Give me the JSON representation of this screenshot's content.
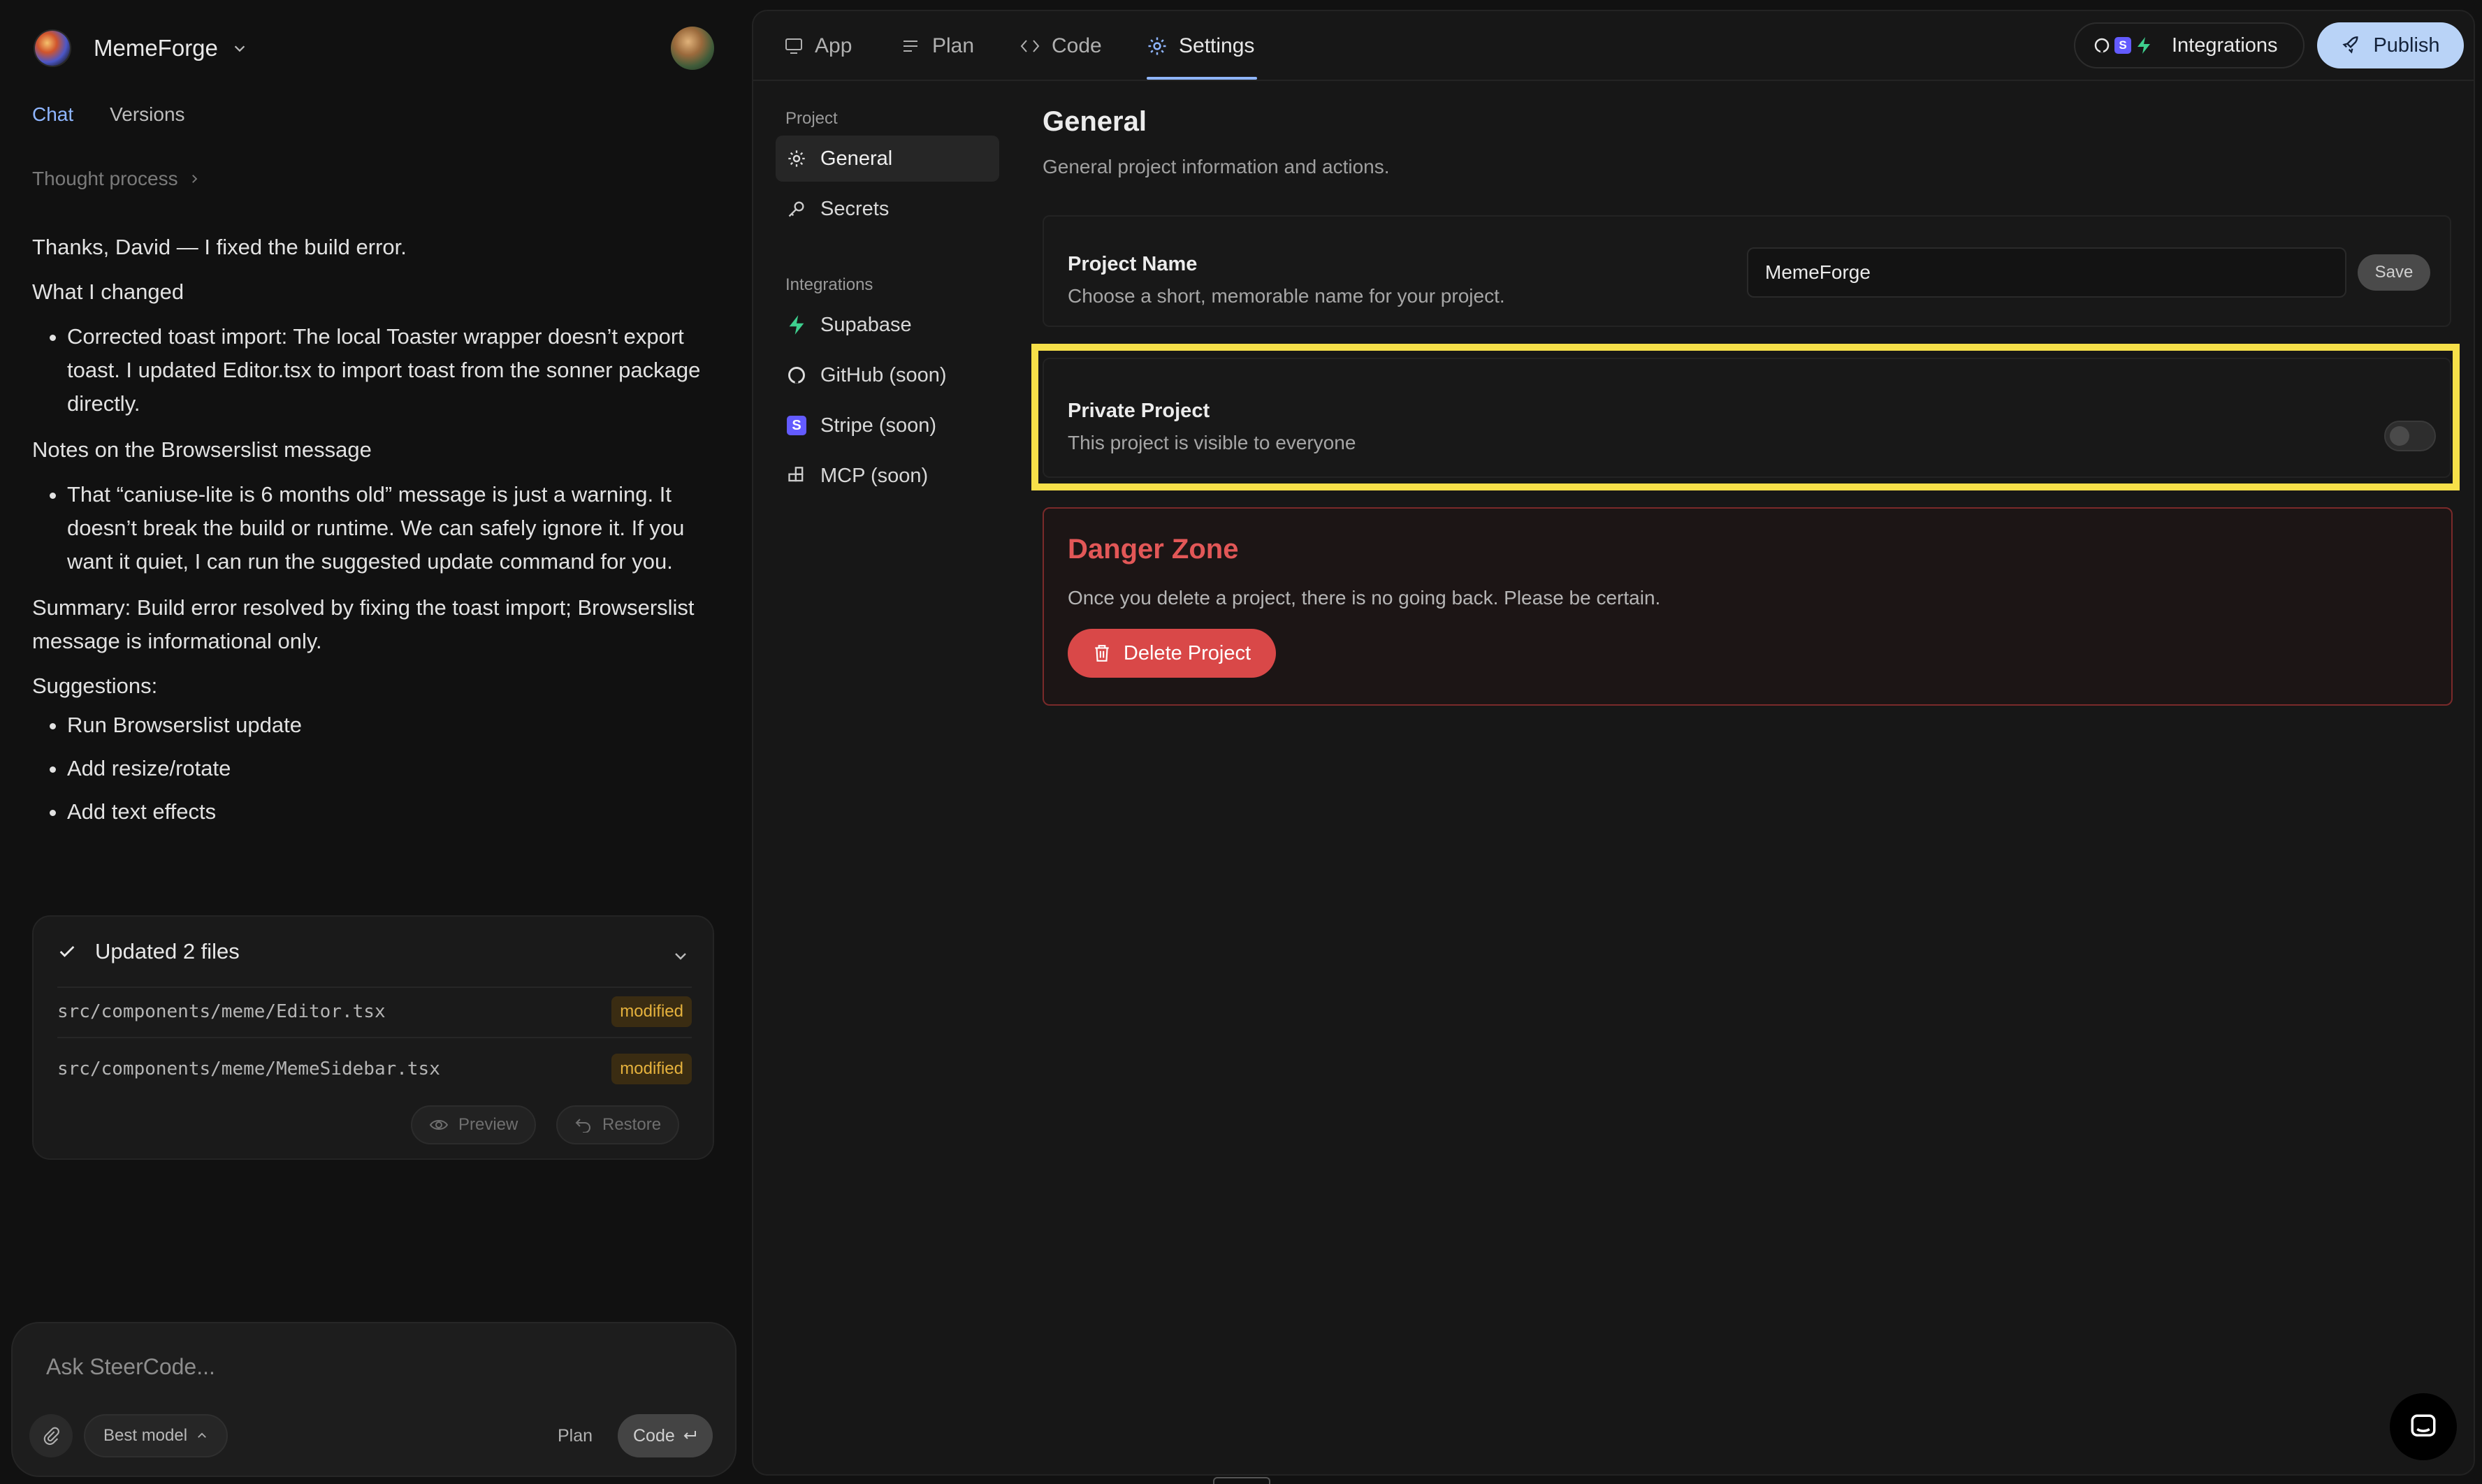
{
  "project": {
    "name": "MemeForge"
  },
  "left_tabs": [
    "Chat",
    "Versions"
  ],
  "thought": "Thought process",
  "message": {
    "greeting": "Thanks, David — I fixed the build error.",
    "changed_heading": "What I changed",
    "changed_items": [
      "Corrected toast import: The local Toaster wrapper doesn’t export toast. I updated Editor.tsx to import toast from the sonner package directly."
    ],
    "notes_heading": "Notes on the Browserslist message",
    "notes_items": [
      "That “caniuse-lite is 6 months old” message is just a warning. It doesn’t break the build or runtime. We can safely ignore it. If you want it quiet, I can run the suggested update command for you."
    ],
    "summary": "Summary: Build error resolved by fixing the toast import; Browserslist message is informational only.",
    "suggestions_heading": "Suggestions:",
    "suggestions": [
      "Run Browserslist update",
      "Add resize/rotate",
      "Add text effects"
    ]
  },
  "files": {
    "title": "Updated 2 files",
    "items": [
      {
        "path": "src/components/meme/Editor.tsx",
        "status": "modified"
      },
      {
        "path": "src/components/meme/MemeSidebar.tsx",
        "status": "modified"
      }
    ],
    "preview_label": "Preview",
    "restore_label": "Restore"
  },
  "composer": {
    "placeholder": "Ask SteerCode...",
    "model_label": "Best model",
    "plan_label": "Plan",
    "code_label": "Code"
  },
  "top_tabs": [
    {
      "label": "App",
      "icon": "monitor-icon"
    },
    {
      "label": "Plan",
      "icon": "list-icon"
    },
    {
      "label": "Code",
      "icon": "code-icon"
    },
    {
      "label": "Settings",
      "icon": "gear-icon"
    }
  ],
  "integrations_label": "Integrations",
  "publish_label": "Publish",
  "sidenav": {
    "project_heading": "Project",
    "project_items": [
      {
        "label": "General",
        "icon": "gear-icon"
      },
      {
        "label": "Secrets",
        "icon": "key-icon"
      }
    ],
    "integrations_heading": "Integrations",
    "integration_items": [
      {
        "label": "Supabase",
        "icon": "supabase-icon"
      },
      {
        "label": "GitHub (soon)",
        "icon": "github-icon"
      },
      {
        "label": "Stripe (soon)",
        "icon": "stripe-icon"
      },
      {
        "label": "MCP (soon)",
        "icon": "mcp-icon"
      }
    ]
  },
  "general": {
    "title": "General",
    "subtitle": "General project information and actions.",
    "project_name_label": "Project Name",
    "project_name_desc": "Choose a short, memorable name for your project.",
    "project_name_value": "MemeForge",
    "save_label": "Save",
    "private_label": "Private Project",
    "private_desc": "This project is visible to everyone",
    "private_enabled": false
  },
  "danger": {
    "title": "Danger Zone",
    "desc": "Once you delete a project, there is no going back. Please be certain.",
    "delete_label": "Delete Project"
  },
  "colors": {
    "accent": "#8fb6ff",
    "danger": "#d94848",
    "highlight": "#f6e049",
    "publish_bg": "#b9d3f7"
  }
}
